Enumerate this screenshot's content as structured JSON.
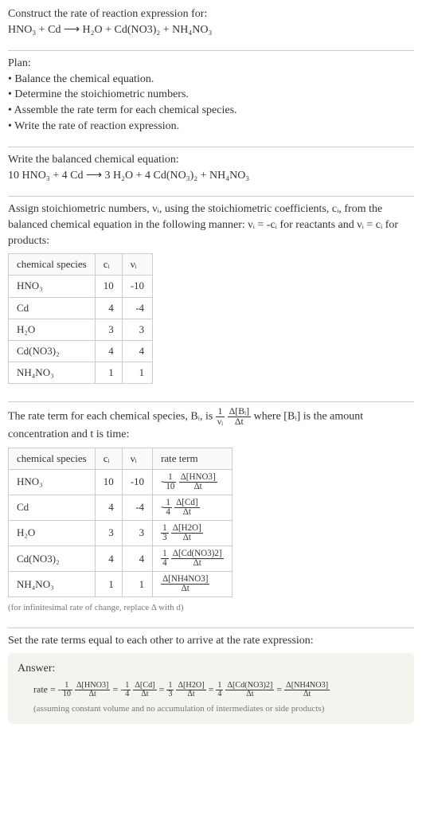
{
  "header": {
    "title": "Construct the rate of reaction expression for:",
    "equation": "HNO₃ + Cd ⟶ H₂O + Cd(NO3)₂ + NH₄NO₃"
  },
  "plan": {
    "title": "Plan:",
    "items": [
      "Balance the chemical equation.",
      "Determine the stoichiometric numbers.",
      "Assemble the rate term for each chemical species.",
      "Write the rate of reaction expression."
    ]
  },
  "balanced": {
    "title": "Write the balanced chemical equation:",
    "equation": "10 HNO₃ + 4 Cd ⟶ 3 H₂O + 4 Cd(NO₃)₂ + NH₄NO₃"
  },
  "stoich": {
    "intro": "Assign stoichiometric numbers, νᵢ, using the stoichiometric coefficients, cᵢ, from the balanced chemical equation in the following manner: νᵢ = -cᵢ for reactants and νᵢ = cᵢ for products:",
    "headers": [
      "chemical species",
      "cᵢ",
      "νᵢ"
    ],
    "rows": [
      {
        "species": "HNO₃",
        "c": "10",
        "v": "-10"
      },
      {
        "species": "Cd",
        "c": "4",
        "v": "-4"
      },
      {
        "species": "H₂O",
        "c": "3",
        "v": "3"
      },
      {
        "species": "Cd(NO3)₂",
        "c": "4",
        "v": "4"
      },
      {
        "species": "NH₄NO₃",
        "c": "1",
        "v": "1"
      }
    ]
  },
  "rateterm": {
    "intro_a": "The rate term for each chemical species, Bᵢ, is ",
    "intro_b": " where [Bᵢ] is the amount concentration and t is time:",
    "headers": [
      "chemical species",
      "cᵢ",
      "νᵢ",
      "rate term"
    ],
    "rows": [
      {
        "species": "HNO₃",
        "c": "10",
        "v": "-10",
        "sign": "-",
        "coef_num": "1",
        "coef_den": "10",
        "delta": "Δ[HNO3]"
      },
      {
        "species": "Cd",
        "c": "4",
        "v": "-4",
        "sign": "-",
        "coef_num": "1",
        "coef_den": "4",
        "delta": "Δ[Cd]"
      },
      {
        "species": "H₂O",
        "c": "3",
        "v": "3",
        "sign": "",
        "coef_num": "1",
        "coef_den": "3",
        "delta": "Δ[H2O]"
      },
      {
        "species": "Cd(NO3)₂",
        "c": "4",
        "v": "4",
        "sign": "",
        "coef_num": "1",
        "coef_den": "4",
        "delta": "Δ[Cd(NO3)2]"
      },
      {
        "species": "NH₄NO₃",
        "c": "1",
        "v": "1",
        "sign": "",
        "coef_num": "",
        "coef_den": "",
        "delta": "Δ[NH4NO3]"
      }
    ],
    "note": "(for infinitesimal rate of change, replace Δ with d)"
  },
  "final": {
    "title": "Set the rate terms equal to each other to arrive at the rate expression:",
    "answer_label": "Answer:",
    "prefix": "rate =",
    "terms": [
      {
        "sign": "-",
        "coef_num": "1",
        "coef_den": "10",
        "delta": "Δ[HNO3]"
      },
      {
        "sign": "-",
        "coef_num": "1",
        "coef_den": "4",
        "delta": "Δ[Cd]"
      },
      {
        "sign": "",
        "coef_num": "1",
        "coef_den": "3",
        "delta": "Δ[H2O]"
      },
      {
        "sign": "",
        "coef_num": "1",
        "coef_den": "4",
        "delta": "Δ[Cd(NO3)2]"
      },
      {
        "sign": "",
        "coef_num": "",
        "coef_den": "",
        "delta": "Δ[NH4NO3]"
      }
    ],
    "note": "(assuming constant volume and no accumulation of intermediates or side products)"
  },
  "dt_label": "Δt"
}
